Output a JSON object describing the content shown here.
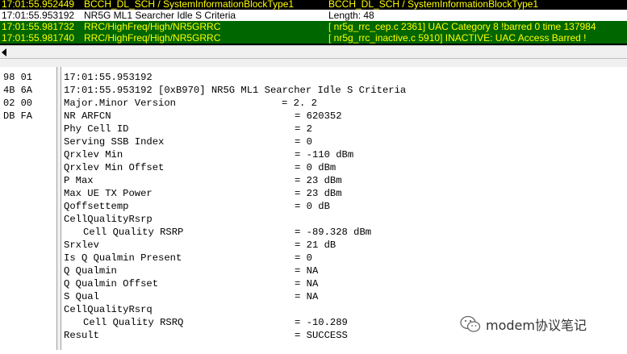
{
  "log": {
    "rows": [
      {
        "time": "17:01:55.952449",
        "subtitle": "BCCH_DL_SCH / SystemInformationBlockType1",
        "info": "BCCH_DL_SCH / SystemInformationBlockType1",
        "style": "yellow"
      },
      {
        "time": "17:01:55.953192",
        "subtitle": "NR5G ML1 Searcher Idle S Criteria",
        "info": "Length:   48",
        "style": "selected"
      },
      {
        "time": "17:01:55.981732",
        "subtitle": "RRC/HighFreq/High/NR5GRRC",
        "info": "[     nr5g_rrc_cep.c    2361]  UAC Category 8 !barred 0 time 137984",
        "style": "green"
      },
      {
        "time": "17:01:55.981740",
        "subtitle": "RRC/HighFreq/High/NR5GRRC",
        "info": "[   nr5g_rrc_inactive.c    5910] INACTIVE: UAC Access Barred  !",
        "style": "green"
      }
    ]
  },
  "colors": {
    "log_bg": "#000000",
    "log_text": "#ffff00",
    "green_row": "#006600"
  },
  "hex": {
    "lines": [
      "98 01",
      "4B 6A",
      "02 00",
      "DB FA"
    ]
  },
  "detail": {
    "lines": [
      {
        "label": "17:01:55.953192",
        "value": ""
      },
      {
        "label": "17:01:55.953192 [0xB970] NR5G ML1 Searcher Idle S Criteria",
        "value": ""
      },
      {
        "label": "Major.Minor Version",
        "value": "= 2. 2",
        "mm": true
      },
      {
        "label": "NR ARFCN",
        "value": "= 620352"
      },
      {
        "label": "Phy Cell ID",
        "value": "= 2"
      },
      {
        "label": "Serving SSB Index",
        "value": "= 0"
      },
      {
        "label": "Qrxlev Min",
        "value": "= -110 dBm"
      },
      {
        "label": "Qrxlev Min Offset",
        "value": "= 0 dBm"
      },
      {
        "label": "P Max",
        "value": "= 23 dBm"
      },
      {
        "label": "Max UE TX Power",
        "value": "= 23 dBm"
      },
      {
        "label": "Qoffsettemp",
        "value": "= 0 dB"
      },
      {
        "label": "CellQualityRsrp",
        "value": ""
      },
      {
        "label": "Cell Quality RSRP",
        "value": "= -89.328 dBm",
        "indent": true
      },
      {
        "label": "Srxlev",
        "value": "= 21 dB"
      },
      {
        "label": "Is Q Qualmin Present",
        "value": "= 0"
      },
      {
        "label": "Q Qualmin",
        "value": "= NA"
      },
      {
        "label": "Q Qualmin Offset",
        "value": "= NA"
      },
      {
        "label": "S Qual",
        "value": "= NA"
      },
      {
        "label": "CellQualityRsrq",
        "value": ""
      },
      {
        "label": "Cell Quality RSRQ",
        "value": "= -10.289",
        "indent": true
      },
      {
        "label": "Result",
        "value": "= SUCCESS"
      }
    ]
  },
  "watermark": {
    "text": "modem协议笔记",
    "icon": "wechat-icon"
  }
}
